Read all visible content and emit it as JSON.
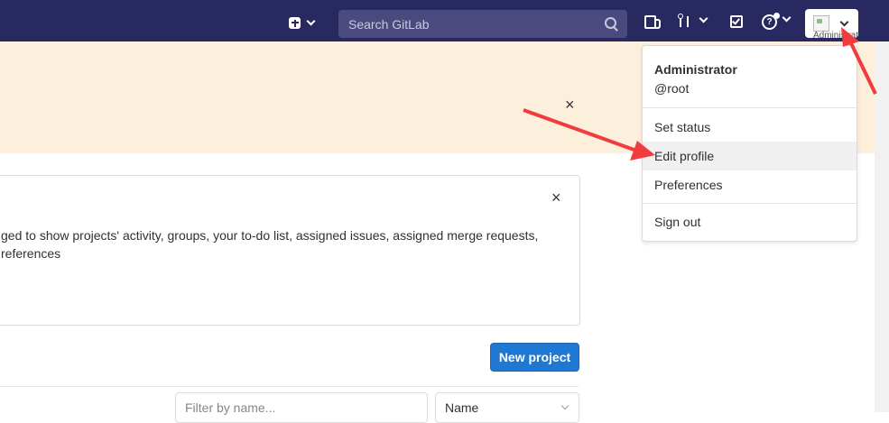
{
  "navbar": {
    "search_placeholder": "Search GitLab",
    "avatar_alt": "Administrator"
  },
  "info": {
    "text_line1": "ged to show projects' activity, groups, your to-do list, assigned issues, assigned merge requests,",
    "text_line2": "references"
  },
  "actions": {
    "new_project": "New project",
    "filter_placeholder": "Filter by name...",
    "sort_selected": "Name"
  },
  "user_menu": {
    "name": "Administrator",
    "username": "@root",
    "items": [
      {
        "label": "Set status"
      },
      {
        "label": "Edit profile"
      },
      {
        "label": "Preferences"
      },
      {
        "label": "Sign out"
      }
    ]
  },
  "colors": {
    "navbar": "#292961",
    "banner": "#fcefdc",
    "primary_button": "#1f78d1",
    "annotation_arrow": "#f03c3c"
  },
  "icons": {
    "close": "×",
    "help": "?"
  }
}
